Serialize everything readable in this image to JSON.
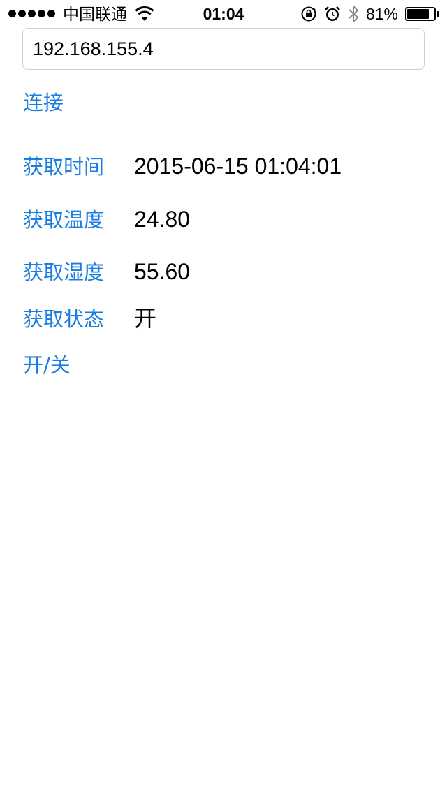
{
  "status_bar": {
    "carrier": "中国联通",
    "time": "01:04",
    "battery_percent_text": "81%",
    "battery_level": 0.81,
    "icons": [
      "signal-dots",
      "wifi-icon",
      "rotation-lock-icon",
      "alarm-icon",
      "bluetooth-icon",
      "battery-icon"
    ]
  },
  "connection": {
    "ip_value": "192.168.155.4",
    "connect_label": "连接"
  },
  "readings": {
    "time_label": "获取时间",
    "time_value": "2015-06-15 01:04:01",
    "temp_label": "获取温度",
    "temp_value": "24.80",
    "humidity_label": "获取湿度",
    "humidity_value": "55.60",
    "state_label": "获取状态",
    "state_value": "开"
  },
  "toggle": {
    "label": "开/关"
  },
  "colors": {
    "link": "#1a7ee0",
    "text": "#000000",
    "border": "#cfcfcf"
  }
}
